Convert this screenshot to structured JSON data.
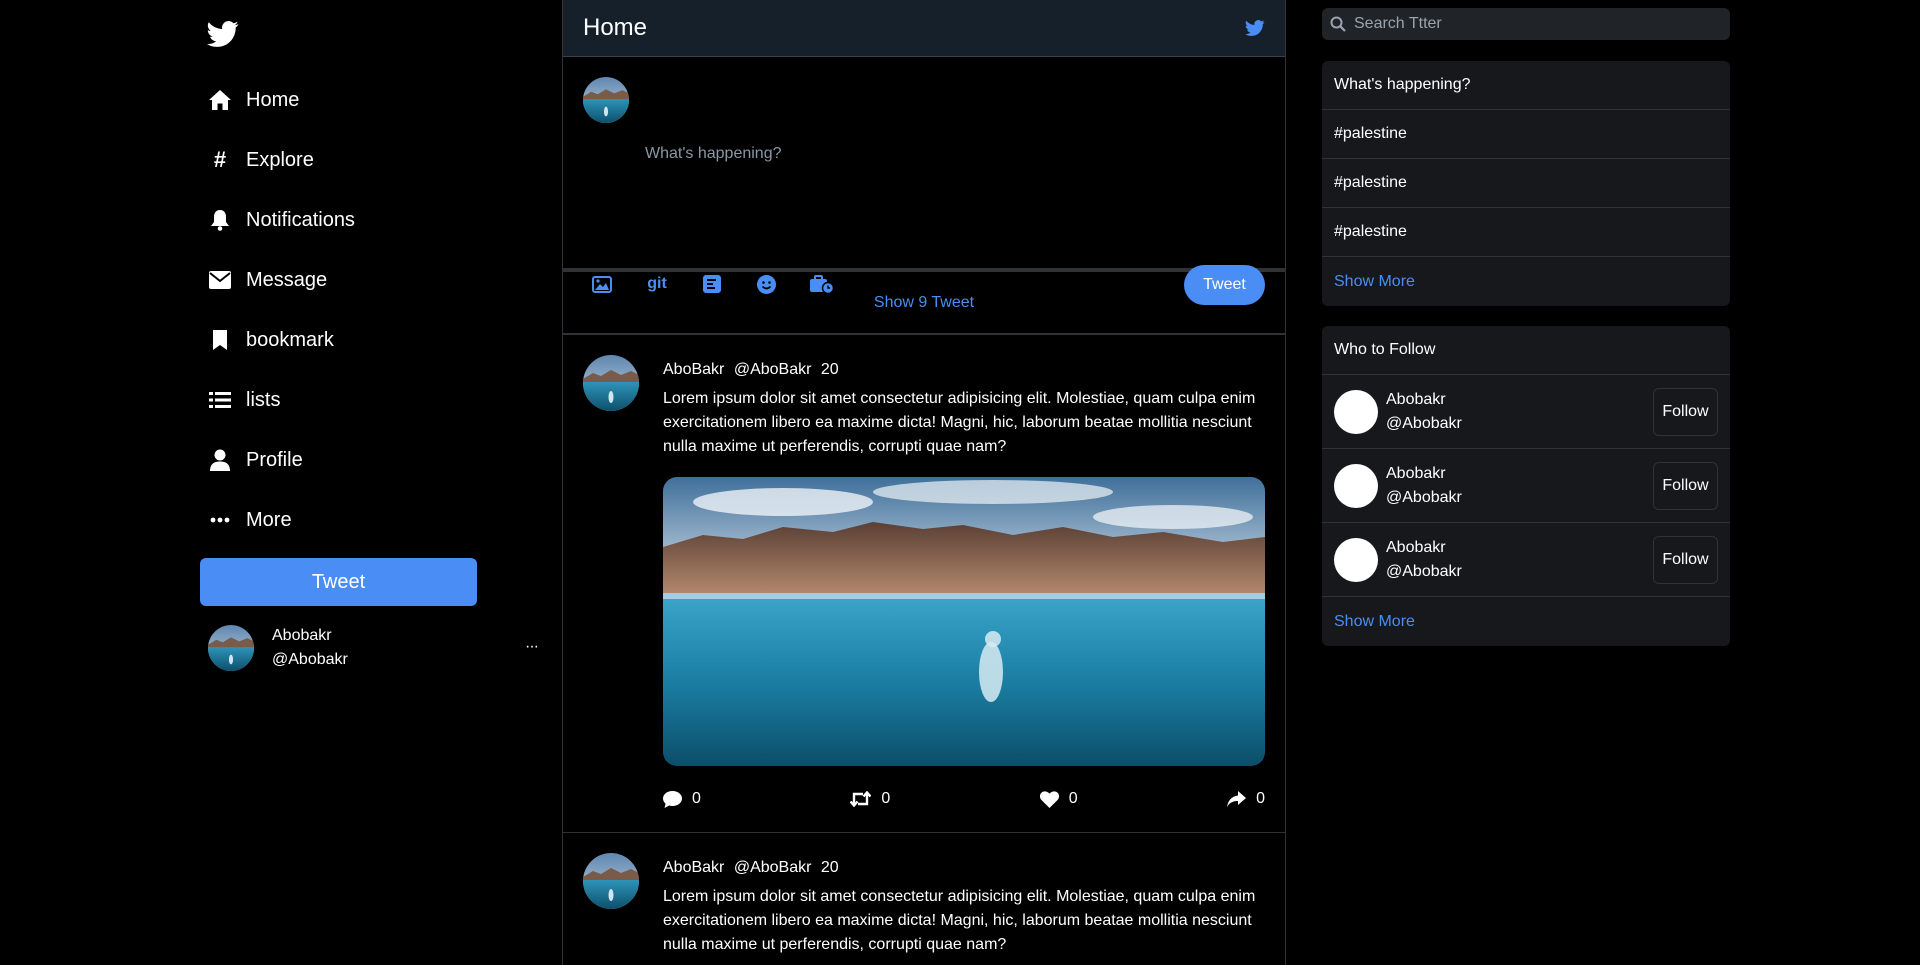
{
  "colors": {
    "accent": "#4a8df5",
    "background": "#000000",
    "header": "#15202b",
    "panel": "#16181c"
  },
  "sidebar": {
    "logo_icon": "twitter-bird-icon",
    "items": [
      {
        "label": "Home",
        "icon": "home-icon"
      },
      {
        "label": "Explore",
        "icon": "hashtag-icon"
      },
      {
        "label": "Notifications",
        "icon": "bell-icon"
      },
      {
        "label": "Message",
        "icon": "envelope-icon"
      },
      {
        "label": "bookmark",
        "icon": "bookmark-icon"
      },
      {
        "label": "lists",
        "icon": "list-icon"
      },
      {
        "label": "Profile",
        "icon": "user-icon"
      },
      {
        "label": "More",
        "icon": "ellipsis-icon"
      }
    ],
    "tweet_button": "Tweet",
    "profile": {
      "name": "Abobakr",
      "handle": "@Abobakr",
      "menu": "···"
    }
  },
  "feed": {
    "title": "Home",
    "composer": {
      "placeholder": "What's happening?",
      "gif_label": "git",
      "tweet_button": "Tweet"
    },
    "show_tweets": "Show 9 Tweet",
    "posts": [
      {
        "name": "AboBakr",
        "handle": "@AboBakr",
        "time": "20",
        "text": "Lorem ipsum dolor sit amet consectetur adipisicing elit. Molestiae, quam culpa enim exercitationem libero ea maxime dicta! Magni, hic, laborum beatae mollitia nesciunt nulla maxime ut perferendis, corrupti quae nam?",
        "replies": "0",
        "retweets": "0",
        "likes": "0",
        "shares": "0"
      },
      {
        "name": "AboBakr",
        "handle": "@AboBakr",
        "time": "20",
        "text": "Lorem ipsum dolor sit amet consectetur adipisicing elit. Molestiae, quam culpa enim exercitationem libero ea maxime dicta! Magni, hic, laborum beatae mollitia nesciunt nulla maxime ut perferendis, corrupti quae nam?"
      }
    ]
  },
  "right": {
    "search_placeholder": "Search Ttter",
    "trends": {
      "title": "What's happening?",
      "items": [
        "#palestine",
        "#palestine",
        "#palestine"
      ],
      "show_more": "Show More"
    },
    "who_to_follow": {
      "title": "Who to Follow",
      "users": [
        {
          "name": "Abobakr",
          "handle": "@Abobakr",
          "button": "Follow"
        },
        {
          "name": "Abobakr",
          "handle": "@Abobakr",
          "button": "Follow"
        },
        {
          "name": "Abobakr",
          "handle": "@Abobakr",
          "button": "Follow"
        }
      ],
      "show_more": "Show More"
    }
  }
}
